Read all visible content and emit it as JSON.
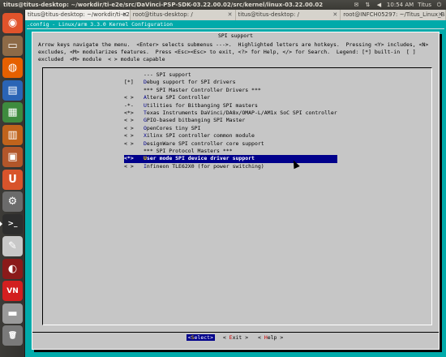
{
  "top_panel": {
    "window_title": "titus@titus-desktop: ~/workdir/ti-e2e/src/DaVinci-PSP-SDK-03.22.00.02/src/kernel/linux-03.22.00.02",
    "time": "10:54 AM",
    "user": "Titus",
    "icons": [
      "mail-icon",
      "network-icon",
      "volume-icon"
    ]
  },
  "launcher": {
    "items": [
      {
        "name": "dash-home",
        "glyph": "◉",
        "color": "#e0532b"
      },
      {
        "name": "files",
        "glyph": "▭",
        "color": "#8d6a47"
      },
      {
        "name": "firefox",
        "glyph": "◍",
        "color": "#e66000"
      },
      {
        "name": "writer",
        "glyph": "▤",
        "color": "#2a64b5"
      },
      {
        "name": "calc",
        "glyph": "▦",
        "color": "#3e8b3e"
      },
      {
        "name": "impress",
        "glyph": "▥",
        "color": "#c0631c"
      },
      {
        "name": "software-center",
        "glyph": "▣",
        "color": "#b2562a"
      },
      {
        "name": "ubuntu-one",
        "glyph": "U",
        "color": "#d8542b"
      },
      {
        "name": "settings",
        "glyph": "⚙",
        "color": "#6b6b6b"
      },
      {
        "name": "terminal",
        "glyph": ">_",
        "color": "#2d2d2d"
      },
      {
        "name": "gedit",
        "glyph": "✎",
        "color": "#c8c8c8"
      },
      {
        "name": "pinta",
        "glyph": "◐",
        "color": "#8b1a1a"
      },
      {
        "name": "vnc",
        "glyph": "VN",
        "color": "#d21f1f"
      },
      {
        "name": "drive",
        "glyph": "▬",
        "color": "#9a9a9a"
      },
      {
        "name": "trash",
        "glyph": "🗑",
        "color": "#7a7a7a"
      }
    ]
  },
  "tabs": [
    {
      "label": "titus@titus-desktop: ~/workdir/ti-e2e...",
      "active": true
    },
    {
      "label": "root@titus-desktop: /",
      "active": false
    },
    {
      "label": "titus@titus-desktop: /",
      "active": false
    },
    {
      "label": "root@INFCH05297: ~/Titus_Linux_Ba...",
      "active": false
    }
  ],
  "terminal": {
    "header": ".config - Linux/arm 3.3.0 Kernel Configuration",
    "dialog_title": "SPI support",
    "help_lines": [
      "Arrow keys navigate the menu.  <Enter> selects submenus --->.  Highlighted letters are hotkeys.  Pressing <Y> includes, <N>",
      "excludes, <M> modularizes features.  Press <Esc><Esc> to exit, <?> for Help, </> for Search.  Legend: [*] built-in  [ ]",
      "excluded  <M> module  < > module capable"
    ],
    "menu": [
      {
        "pre": "",
        "hot": "",
        "rest": "--- SPI support",
        "sel": false
      },
      {
        "pre": "[*]",
        "hot": "D",
        "rest": "ebug support for SPI drivers",
        "sel": false
      },
      {
        "pre": "",
        "hot": "",
        "rest": "*** SPI Master Controller Drivers ***",
        "sel": false
      },
      {
        "pre": "< >",
        "hot": "A",
        "rest": "ltera SPI Controller",
        "sel": false
      },
      {
        "pre": "-*-",
        "hot": "U",
        "rest": "tilities for Bitbanging SPI masters",
        "sel": false
      },
      {
        "pre": "<*>",
        "hot": "T",
        "rest": "exas Instruments DaVinci/DA8x/OMAP-L/AM1x SoC SPI controller",
        "sel": false
      },
      {
        "pre": "< >",
        "hot": "G",
        "rest": "PIO-based bitbanging SPI Master",
        "sel": false
      },
      {
        "pre": "< >",
        "hot": "O",
        "rest": "penCores tiny SPI",
        "sel": false
      },
      {
        "pre": "< >",
        "hot": "X",
        "rest": "ilinx SPI controller common module",
        "sel": false
      },
      {
        "pre": "< >",
        "hot": "D",
        "rest": "esignWare SPI controller core support",
        "sel": false
      },
      {
        "pre": "",
        "hot": "",
        "rest": "*** SPI Protocol Masters ***",
        "sel": false
      },
      {
        "pre": "<*>",
        "hot": "U",
        "rest": "ser mode SPI device driver support",
        "sel": true
      },
      {
        "pre": "< >",
        "hot": "I",
        "rest": "nfineon TLE62X0 (for power switching)",
        "sel": false
      }
    ],
    "buttons": [
      {
        "label": "<Select>",
        "hotkey": "S",
        "selected": true
      },
      {
        "label": "< Exit >",
        "hotkey": "E",
        "selected": false
      },
      {
        "label": "< Help >",
        "hotkey": "H",
        "selected": false
      }
    ]
  }
}
